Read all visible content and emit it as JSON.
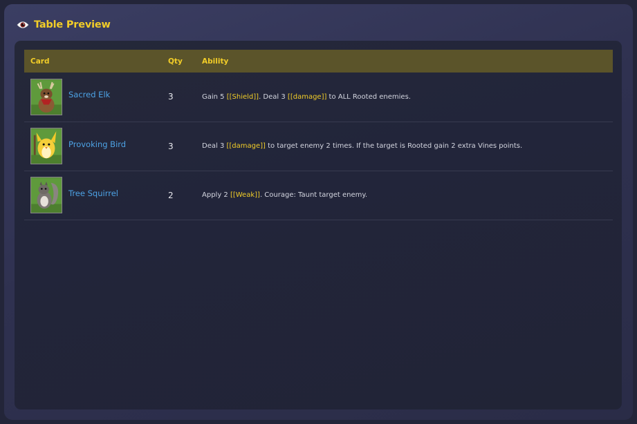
{
  "header": {
    "title": "Table Preview",
    "icon": "eye-icon",
    "accent": "#f2cd28"
  },
  "table": {
    "columns": [
      "Card",
      "Qty",
      "Ability"
    ],
    "rows": [
      {
        "name": "Sacred Elk",
        "qty": "3",
        "icon": "sacred-elk-portrait",
        "ability": [
          {
            "t": "Gain 5 ",
            "k": false
          },
          {
            "t": "[[Shield]]",
            "k": true
          },
          {
            "t": ". Deal 3 ",
            "k": false
          },
          {
            "t": "[[damage]]",
            "k": true
          },
          {
            "t": " to ALL Rooted enemies.",
            "k": false
          }
        ]
      },
      {
        "name": "Provoking Bird",
        "qty": "3",
        "icon": "provoking-bird-portrait",
        "ability": [
          {
            "t": "Deal 3 ",
            "k": false
          },
          {
            "t": "[[damage]]",
            "k": true
          },
          {
            "t": " to target enemy 2 times. If the target is Rooted gain 2 extra Vines points.",
            "k": false
          }
        ]
      },
      {
        "name": "Tree Squirrel",
        "qty": "2",
        "icon": "tree-squirrel-portrait",
        "ability": [
          {
            "t": "Apply 2 ",
            "k": false
          },
          {
            "t": "[[Weak]]",
            "k": true
          },
          {
            "t": ". Courage: Taunt target enemy.",
            "k": false
          }
        ]
      }
    ]
  },
  "colors": {
    "card_name": "#4da3e6",
    "header_row": "#5b542a",
    "panel": "#22253a"
  }
}
